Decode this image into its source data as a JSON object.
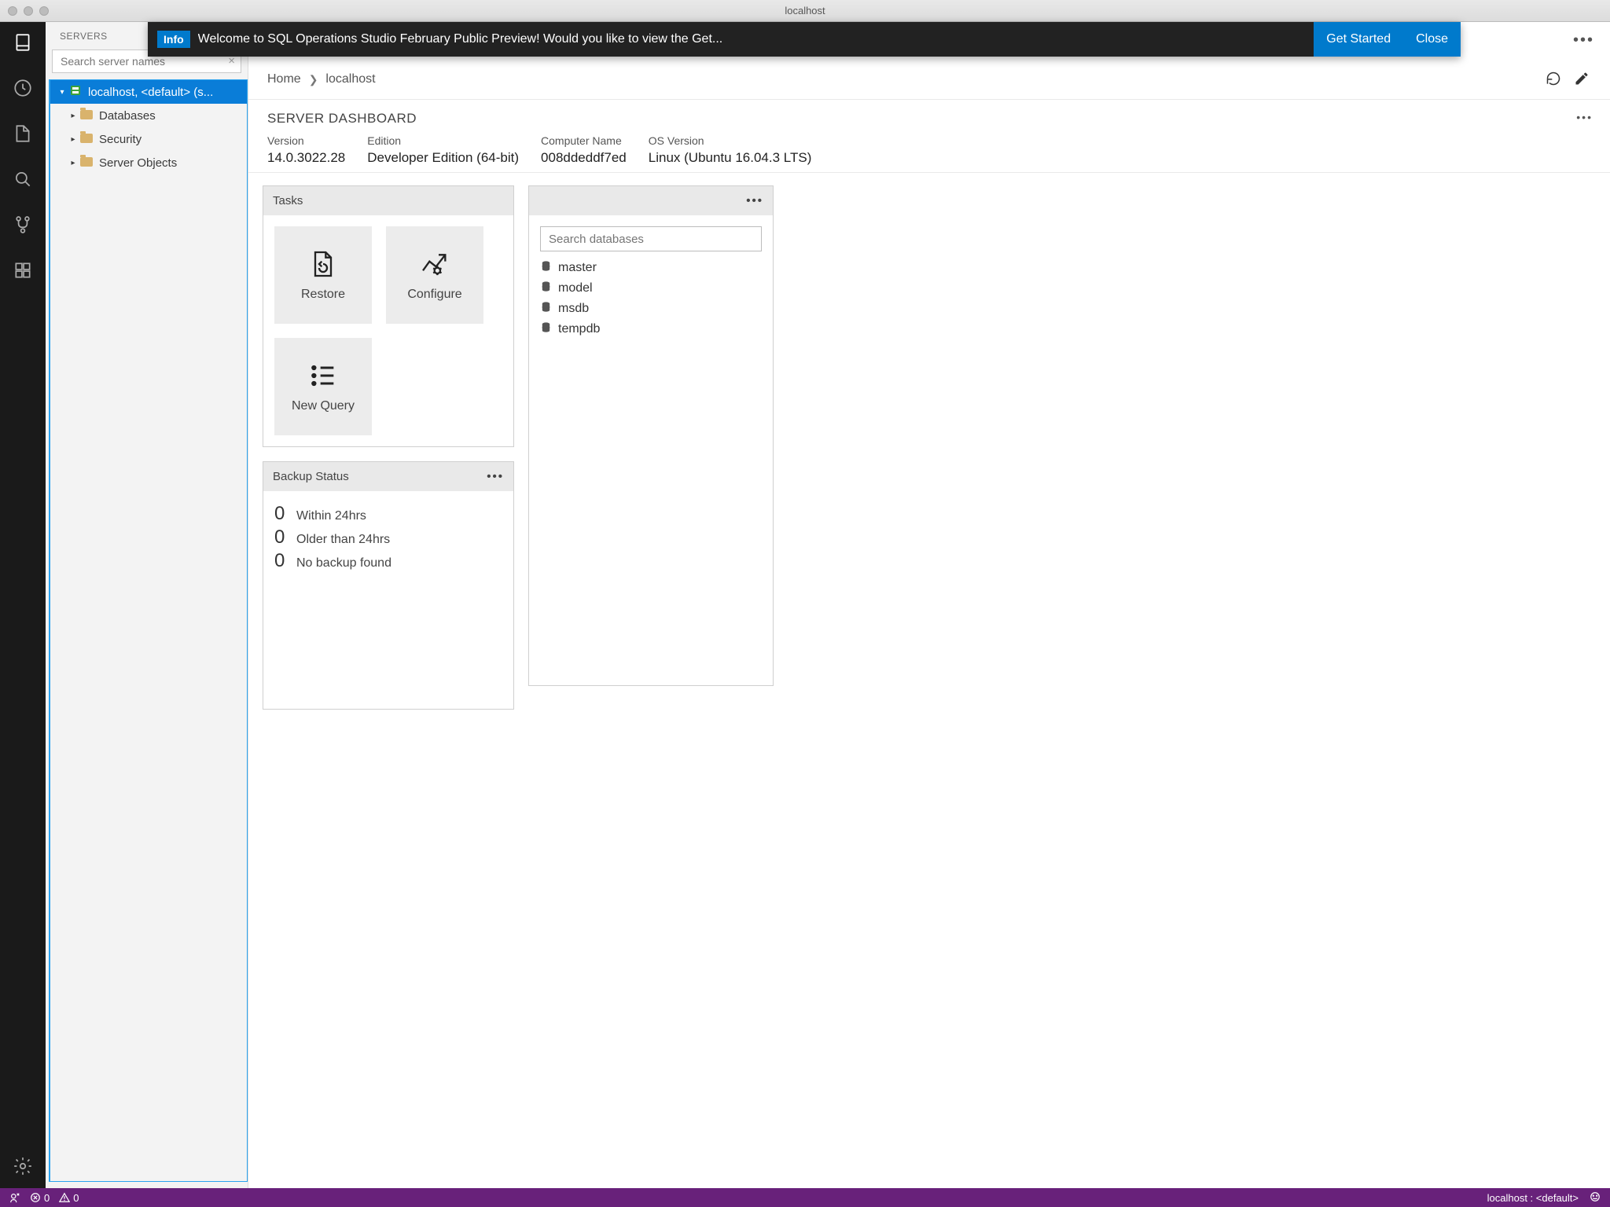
{
  "window": {
    "title": "localhost"
  },
  "notification": {
    "badge": "Info",
    "message": "Welcome to SQL Operations Studio February Public Preview! Would you like to view the Get...",
    "get_started": "Get Started",
    "close": "Close"
  },
  "sidebar": {
    "title": "SERVERS",
    "search_placeholder": "Search server names",
    "root": "localhost, <default> (s...",
    "items": [
      "Databases",
      "Security",
      "Server Objects"
    ]
  },
  "breadcrumb": {
    "a": "Home",
    "b": "localhost"
  },
  "dashboard": {
    "title": "SERVER DASHBOARD",
    "info": [
      {
        "label": "Version",
        "value": "14.0.3022.28"
      },
      {
        "label": "Edition",
        "value": "Developer Edition (64-bit)"
      },
      {
        "label": "Computer Name",
        "value": "008ddeddf7ed"
      },
      {
        "label": "OS Version",
        "value": "Linux (Ubuntu 16.04.3 LTS)"
      }
    ]
  },
  "tasks": {
    "title": "Tasks",
    "tiles": {
      "restore": "Restore",
      "configure": "Configure",
      "new_query": "New Query"
    }
  },
  "databases": {
    "search_placeholder": "Search databases",
    "list": [
      "master",
      "model",
      "msdb",
      "tempdb"
    ]
  },
  "backup": {
    "title": "Backup Status",
    "rows": [
      {
        "n": "0",
        "t": "Within 24hrs"
      },
      {
        "n": "0",
        "t": "Older than 24hrs"
      },
      {
        "n": "0",
        "t": "No backup found"
      }
    ]
  },
  "status": {
    "errors": "0",
    "warnings": "0",
    "connection": "localhost : <default>"
  }
}
